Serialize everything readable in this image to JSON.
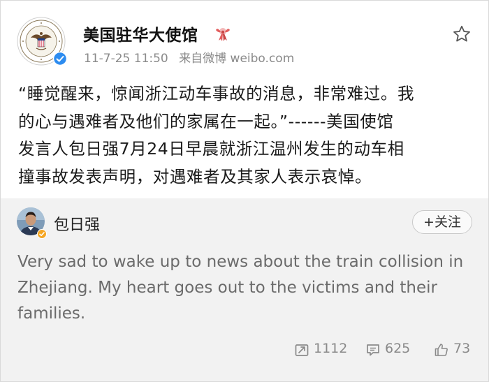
{
  "post": {
    "author": "美国驻华大使馆",
    "time": "11-7-25 11:50",
    "source": "来自微博 weibo.com",
    "text_lines": [
      "“睡觉醒来，惊闻浙江动车事故的消息，非常难过。我",
      "的心与遇难者及他们的家属在一起。”------美国使馆",
      "发言人包日强7月24日早晨就浙江温州发生的动车相",
      "撞事故发表声明，对遇难者及其家人表示哀悼。"
    ]
  },
  "retweet": {
    "author": "包日强",
    "follow_label": "+关注",
    "text": "Very sad to wake up to news about the train collision in Zhejiang.  My heart goes out to the victims and their families."
  },
  "actions": {
    "repost_count": "1112",
    "comment_count": "625",
    "like_count": "73"
  },
  "colors": {
    "meta_gray": "#8a8a8a",
    "retweet_bg": "#f2f2f2",
    "verified_blue": "#2d8cf0",
    "verified_gold": "#f5a623"
  },
  "icons": [
    "verified-icon",
    "ribbon-icon",
    "star-icon",
    "repost-icon",
    "comment-icon",
    "like-icon"
  ]
}
